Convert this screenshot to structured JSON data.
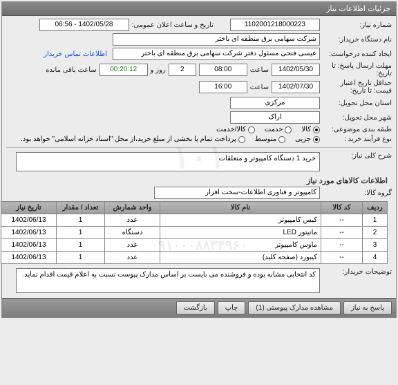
{
  "header": {
    "title": "جزئیات اطلاعات نیاز"
  },
  "form": {
    "need_no_label": "شماره نیاز:",
    "need_no": "1102001218000223",
    "public_date_label": "تاریخ و ساعت اعلان عمومی:",
    "public_date": "1402/05/28 - 06:56",
    "buyer_label": "نام دستگاه خریدار:",
    "buyer": "شرکت سهامی برق منطقه ای باختر",
    "creator_label": "ایجاد کننده درخواست:",
    "creator": "عیسی فتحی مسئول دفتر شرکت سهامی برق منطقه ای باختر",
    "contact_link": "اطلاعات تماس خریدار",
    "deadline_label": "مهلت ارسال پاسخ: تا تاریخ:",
    "deadline_date": "1402/05/30",
    "time_word": "ساعت",
    "deadline_time": "08:00",
    "days": "2",
    "day_and": "روز و",
    "remain_time": "00:20:12",
    "remain_text": "ساعت باقی مانده",
    "validity_label": "حداقل تاریخ اعتبار قیمت: تا تاریخ:",
    "validity_date": "1402/07/30",
    "validity_time": "16:00",
    "province_label": "استان محل تحویل:",
    "province": "مرکزی",
    "city_label": "شهر محل تحویل:",
    "city": "اراک",
    "class_label": "طبقه بندی موضوعی:",
    "class_opts": {
      "goods": "کالا",
      "service": "خدمت",
      "both": "کالا/خدمت"
    },
    "buy_type_label": "نوع فرآیند خرید :",
    "buy_opts": {
      "partial": "جزیی",
      "mid": "متوسط"
    },
    "buy_note": "پرداخت تمام یا بخشی از مبلغ خرید،از محل \"اسناد خزانه اسلامی\" خواهد بود.",
    "desc_label": "شرح کلی نیاز:",
    "desc": "خرید 1 دستگاه کامپیوتر و متعلقات",
    "goods_section": "اطلاعات کالاهای مورد نیاز",
    "group_label": "گروه کالا:",
    "group": "کامپیوتر و فناوری اطلاعات-سخت افزار",
    "buyer_note_label": "توضیحات خریدار:",
    "buyer_note": "کد انتخابی مشابه بوده و فروشنده می بایست بر اساس مدارک پیوست نسبت به اعلام قیمت اقدام نماید."
  },
  "table": {
    "headers": {
      "row": "ردیف",
      "code": "کد کالا",
      "name": "نام کالا",
      "unit": "واحد شمارش",
      "qty": "تعداد / مقدار",
      "date": "تاریخ نیاز"
    },
    "rows": [
      {
        "row": "1",
        "code": "--",
        "name": "کیس کامپیوتر",
        "unit": "عدد",
        "qty": "1",
        "date": "1402/06/13"
      },
      {
        "row": "2",
        "code": "--",
        "name": "مانیتور LED",
        "unit": "دستگاه",
        "qty": "1",
        "date": "1402/06/13"
      },
      {
        "row": "3",
        "code": "--",
        "name": "ماوس کامپیوتر",
        "unit": "عدد",
        "qty": "1",
        "date": "1402/06/13"
      },
      {
        "row": "4",
        "code": "--",
        "name": "کیبورد (صفحه کلید)",
        "unit": "عدد",
        "qty": "1",
        "date": "1402/06/13"
      }
    ]
  },
  "footer": {
    "reply": "پاسخ به نیاز",
    "attachments": "مشاهده مدارک پیوستی (1)",
    "print": "چاپ",
    "back": "بازگشت"
  },
  "watermark": {
    "a": "۱۰۱",
    "b": "۰۹۱۰۰۰۸۸۳۴۹۶۰"
  }
}
